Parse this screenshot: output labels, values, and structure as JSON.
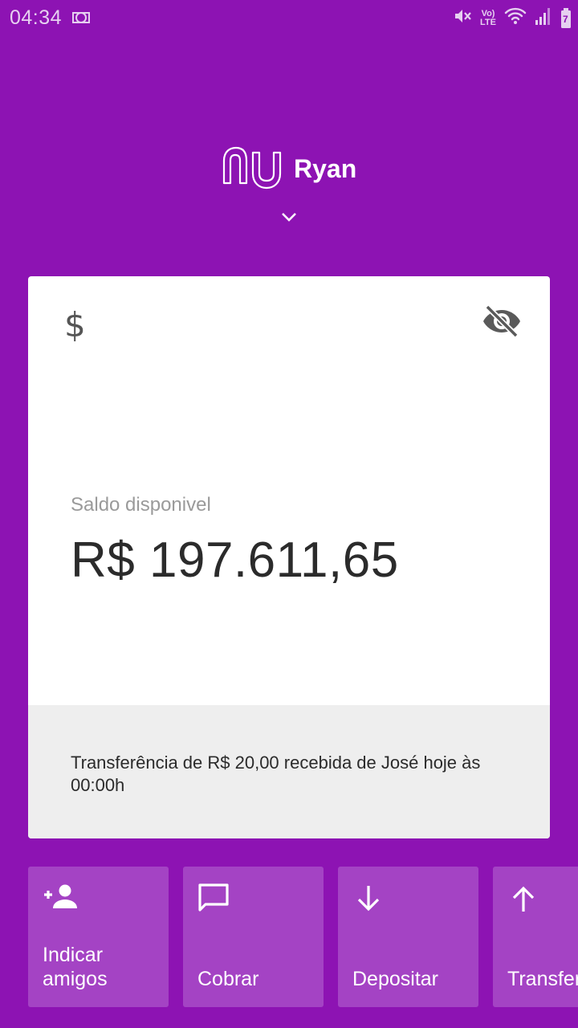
{
  "status_bar": {
    "time": "04:34",
    "icons": [
      "link-icon",
      "mute-icon",
      "volte-icon",
      "wifi-icon",
      "signal-icon",
      "battery-icon"
    ],
    "volte_top": "Vo)",
    "volte_bottom": "LTE",
    "battery_level": "7"
  },
  "header": {
    "logo_icon": "nu-logo-icon",
    "name": "Ryan",
    "chevron_icon": "chevron-down-icon"
  },
  "card": {
    "dollar_symbol": "$",
    "visibility_icon": "eye-off-icon",
    "balance_label": "Saldo disponivel",
    "balance_value": "R$ 197.611,65",
    "notice": "Transferência de R$ 20,00 recebida de José hoje às 00:00h"
  },
  "shortcuts": [
    {
      "icon": "add-person-icon",
      "label": "Indicar\namigos"
    },
    {
      "icon": "chat-icon",
      "label": "Cobrar"
    },
    {
      "icon": "arrow-down-icon",
      "label": "Depositar"
    },
    {
      "icon": "arrow-up-icon",
      "label": "Transferir"
    }
  ],
  "colors": {
    "background": "#8d13b3",
    "card": "#ffffff",
    "card_footer": "#eeeeee",
    "shortcut": "#a443c4"
  }
}
